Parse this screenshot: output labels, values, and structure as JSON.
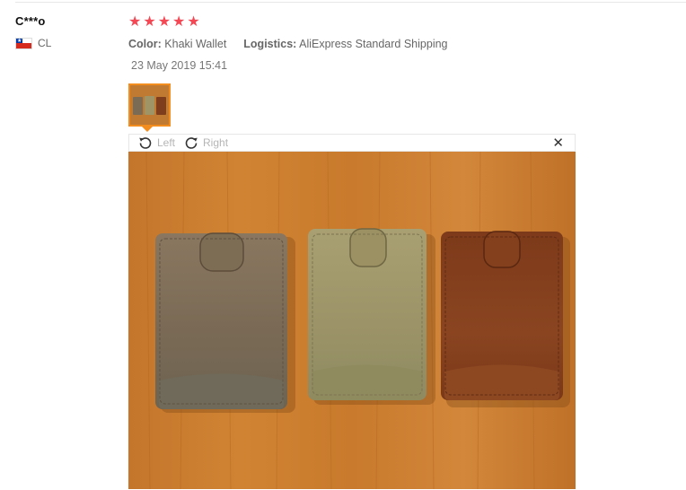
{
  "review": {
    "user_name": "C***o",
    "country_code": "CL",
    "rating": 5,
    "stars": [
      "★",
      "★",
      "★",
      "★",
      "★"
    ],
    "color_label": "Color:",
    "color_value": "Khaki Wallet",
    "logistics_label": "Logistics:",
    "logistics_value": "AliExpress Standard Shipping",
    "date": "23 May 2019 15:41"
  },
  "viewer": {
    "rotate_left": "Left",
    "rotate_right": "Right",
    "close_glyph": "✕"
  },
  "colors": {
    "star": "#f44855",
    "thumb_border": "#f48d20",
    "muted_text": "#b5b5b5"
  },
  "icons": {
    "flag": "chile-flag-icon",
    "rotate_left": "rotate-left-icon",
    "rotate_right": "rotate-right-icon",
    "close": "close-icon"
  }
}
